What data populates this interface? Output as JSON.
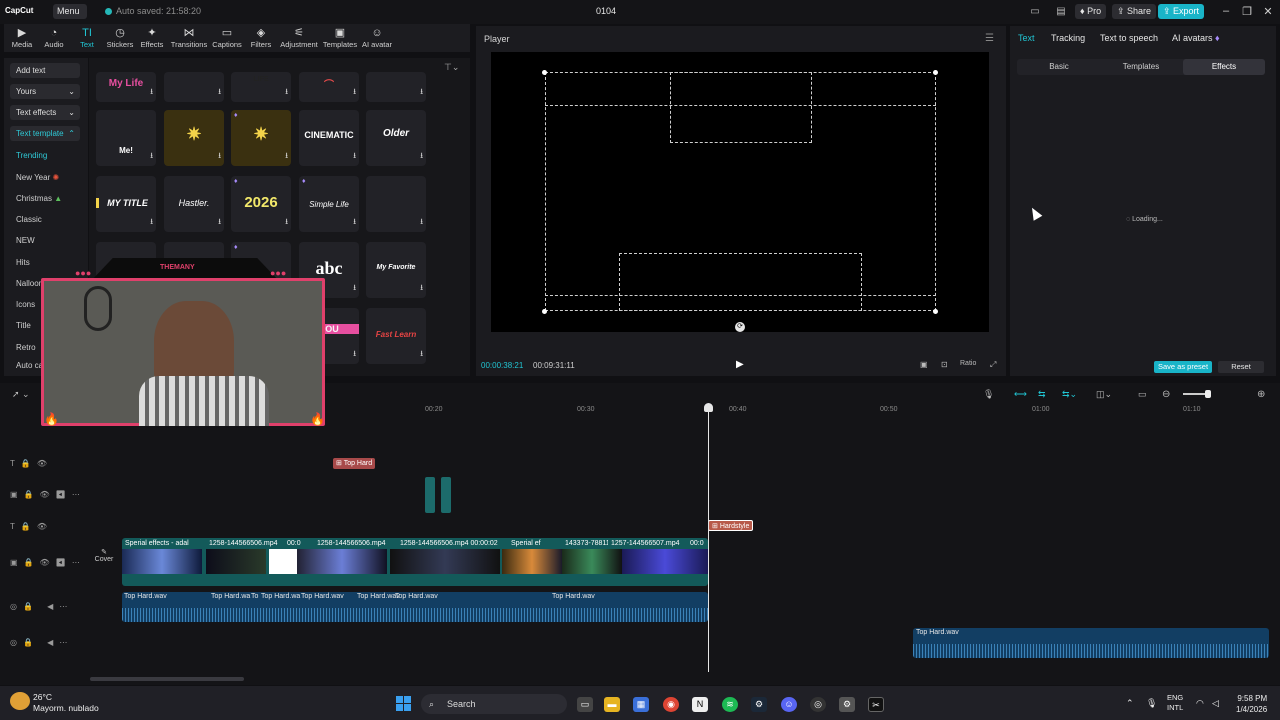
{
  "titlebar": {
    "logo": "CapCut",
    "menu": "Menu",
    "autosave": "Auto saved: 21:58:20",
    "project": "0104",
    "pro": "Pro",
    "share": "Share",
    "export": "Export"
  },
  "toolbar": {
    "tools": [
      "Media",
      "Audio",
      "Text",
      "Stickers",
      "Effects",
      "Transitions",
      "Captions",
      "Filters",
      "Adjustment",
      "Templates",
      "AI avatar"
    ]
  },
  "leftnav": {
    "add_text": "Add text",
    "yours": "Yours",
    "text_effects": "Text effects",
    "text_template": "Text template",
    "items": [
      "Trending",
      "New Year",
      "Christmas",
      "Classic",
      "NEW",
      "Hits",
      "Nalloon",
      "Icons",
      "Title",
      "Retro",
      "Auto cap"
    ]
  },
  "gallery": {
    "row1": [
      "My Life",
      "",
      "LIFE",
      "",
      ""
    ],
    "row2": [
      "Me!",
      "",
      "",
      "CINEMATIC",
      "Older"
    ],
    "row3": [
      "MY TITLE",
      "Hastler.",
      "2026",
      "Simple Life",
      ""
    ],
    "row4": [
      "",
      "THEMANY",
      "",
      "abc",
      "My Favorite"
    ],
    "row5": [
      "",
      "",
      "",
      "YOU",
      "Fast Learn"
    ]
  },
  "player": {
    "title": "Player",
    "current_time": "00:00:38:21",
    "total_time": "00:09:31:11",
    "ratio": "Ratio"
  },
  "props": {
    "tabs": [
      "Text",
      "Tracking",
      "Text to speech",
      "AI avatars"
    ],
    "subtabs": [
      "Basic",
      "Templates",
      "Effects"
    ],
    "loading": "Loading...",
    "save_preset": "Save as preset",
    "reset": "Reset"
  },
  "timeline": {
    "ruler": [
      "00:20",
      "00:30",
      "00:40",
      "00:50",
      "01:00",
      "01:10"
    ],
    "text_clip1": "Top Hard",
    "text_clip2": "Hardstyle",
    "cover": "Cover",
    "video_clips": [
      "Sperial effects - adal",
      "1258-144566506.mp4",
      "00:0",
      "1258-144566506.mp4",
      "1258-144566506.mp4 00:00:02",
      "Sperial ef",
      "143373-78811",
      "1257-144566507.mp4",
      "00:0"
    ],
    "audio_clips": [
      "Top Hard.wav",
      "Top Hard.wa",
      "To",
      "Top Hard.wa",
      "Top Hard.wav",
      "Top Hard.wav",
      "Top Hard.wav",
      "Top Hard.wav"
    ],
    "audio_clip2": "Top Hard.wav"
  },
  "taskbar": {
    "temp": "26°C",
    "weather": "Mayorm. nublado",
    "search": "Search",
    "lang1": "ENG",
    "lang2": "INTL",
    "time": "9:58 PM",
    "date": "1/4/2026"
  }
}
